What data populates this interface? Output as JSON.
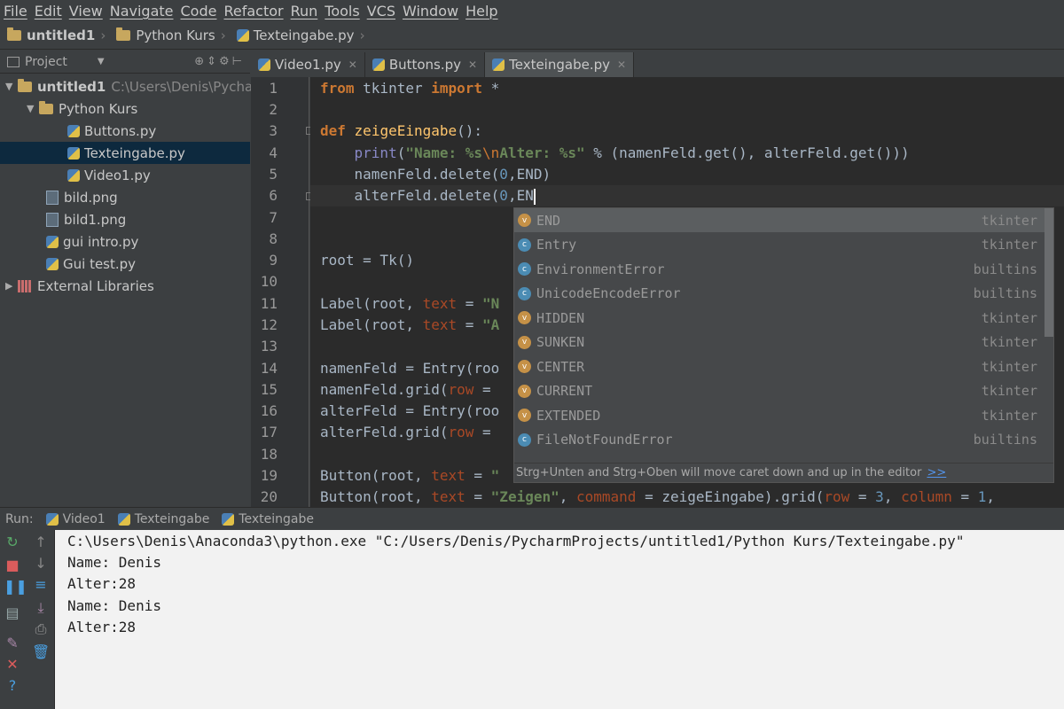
{
  "menu": [
    "File",
    "Edit",
    "View",
    "Navigate",
    "Code",
    "Refactor",
    "Run",
    "Tools",
    "VCS",
    "Window",
    "Help"
  ],
  "breadcrumbs": [
    "untitled1",
    "Python Kurs",
    "Texteingabe.py"
  ],
  "project_panel": {
    "title": "Project"
  },
  "tabs": [
    {
      "label": "Video1.py"
    },
    {
      "label": "Buttons.py"
    },
    {
      "label": "Texteingabe.py"
    }
  ],
  "tree": [
    {
      "label": "untitled1",
      "extra": "C:\\Users\\Denis\\Pychar",
      "icon": "folder-icon"
    },
    {
      "label": "Python Kurs",
      "icon": "folder-icon"
    },
    {
      "label": "Buttons.py",
      "icon": "python-file-icon"
    },
    {
      "label": "Texteingabe.py",
      "icon": "python-file-icon"
    },
    {
      "label": "Video1.py",
      "icon": "python-file-icon"
    },
    {
      "label": "bild.png",
      "icon": "image-file-icon"
    },
    {
      "label": "bild1.png",
      "icon": "image-file-icon"
    },
    {
      "label": "gui intro.py",
      "icon": "python-file-icon"
    },
    {
      "label": "Gui test.py",
      "icon": "python-file-icon"
    },
    {
      "label": "External Libraries",
      "icon": "library-icon"
    }
  ],
  "line_numbers": [
    "1",
    "2",
    "3",
    "4",
    "5",
    "6",
    "7",
    "8",
    "9",
    "10",
    "11",
    "12",
    "13",
    "14",
    "15",
    "16",
    "17",
    "18",
    "19",
    "20"
  ],
  "code": {
    "l1": {
      "a": "from",
      "b": " tkinter ",
      "c": "import",
      "d": " *"
    },
    "l3": {
      "a": "def",
      "b": " ",
      "c": "zeigeEingabe",
      "d": "():"
    },
    "l4": {
      "a": "    ",
      "b": "print",
      "c": "(",
      "d": "\"Name: %s",
      "e": "\\n",
      "f": "Alter: %s\"",
      "g": " % (namenFeld.get(), alterFeld.get()))"
    },
    "l5": {
      "a": "    namenFeld.delete(",
      "b": "0",
      "c": ",END)"
    },
    "l6": {
      "a": "    alterFeld.delete(",
      "b": "0",
      "c": ",EN"
    },
    "l9": {
      "a": "root = Tk()"
    },
    "l11": {
      "a": "Label(root, ",
      "b": "text",
      "c": " = ",
      "d": "\"N"
    },
    "l12": {
      "a": "Label(root, ",
      "b": "text",
      "c": " = ",
      "d": "\"A"
    },
    "l14": {
      "a": "namenFeld = Entry(roo"
    },
    "l15": {
      "a": "namenFeld.grid(",
      "b": "row",
      "c": " ="
    },
    "l16": {
      "a": "alterFeld = Entry(roo"
    },
    "l17": {
      "a": "alterFeld.grid(",
      "b": "row",
      "c": " ="
    },
    "l19": {
      "a": "Button(root, ",
      "b": "text",
      "c": " = ",
      "d": "\""
    },
    "l20": {
      "a": "Button(root, ",
      "b": "text",
      "c": " = ",
      "d": "\"Zeigen\"",
      "e": ", ",
      "f": "command",
      "g": " = zeigeEingabe).grid(",
      "h": "row",
      "i": " = ",
      "j": "3",
      "k": ", ",
      "l": "column",
      "m": " = ",
      "n": "1",
      "o": ","
    }
  },
  "completion": {
    "items": [
      {
        "kind": "v",
        "name": "END",
        "source": "tkinter"
      },
      {
        "kind": "c",
        "name": "Entry",
        "source": "tkinter"
      },
      {
        "kind": "c",
        "name": "EnvironmentError",
        "source": "builtins"
      },
      {
        "kind": "c",
        "name": "UnicodeEncodeError",
        "source": "builtins"
      },
      {
        "kind": "v",
        "name": "HIDDEN",
        "source": "tkinter"
      },
      {
        "kind": "v",
        "name": "SUNKEN",
        "source": "tkinter"
      },
      {
        "kind": "v",
        "name": "CENTER",
        "source": "tkinter"
      },
      {
        "kind": "v",
        "name": "CURRENT",
        "source": "tkinter"
      },
      {
        "kind": "v",
        "name": "EXTENDED",
        "source": "tkinter"
      },
      {
        "kind": "c",
        "name": "FileNotFoundError",
        "source": "builtins"
      }
    ],
    "hint": "Strg+Unten and Strg+Oben will move caret down and up in the editor",
    "hint_link": ">>"
  },
  "run": {
    "label": "Run:",
    "tabs": [
      "Video1",
      "Texteingabe",
      "Texteingabe"
    ]
  },
  "console": [
    "C:\\Users\\Denis\\Anaconda3\\python.exe \"C:/Users/Denis/PycharmProjects/untitled1/Python Kurs/Texteingabe.py\"",
    "Name: Denis",
    "Alter:28",
    "Name: Denis",
    "Alter:28"
  ],
  "colors": {
    "keyword": "#cc7832",
    "function": "#ffc66d",
    "string": "#6a8759",
    "number": "#6897bb",
    "selection": "#0d293e"
  }
}
